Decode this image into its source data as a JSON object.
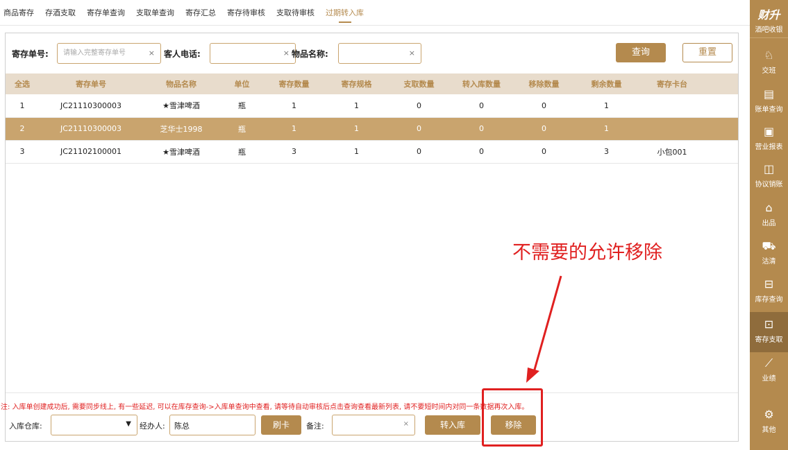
{
  "tabs": [
    {
      "label": "商品寄存"
    },
    {
      "label": "存酒支取"
    },
    {
      "label": "寄存单查询"
    },
    {
      "label": "支取单查询"
    },
    {
      "label": "寄存汇总"
    },
    {
      "label": "寄存待审核"
    },
    {
      "label": "支取待审核"
    },
    {
      "label": "过期转入库"
    }
  ],
  "search": {
    "order_no_label": "寄存单号:",
    "order_no_placeholder": "请输入完整寄存单号",
    "phone_label": "客人电话:",
    "phone_value": "",
    "item_label": "物品名称:",
    "item_value": "",
    "clear_icon": "×",
    "query_button": "查询",
    "reset_button": "重置"
  },
  "table": {
    "headers": [
      "全选",
      "寄存单号",
      "物品名称",
      "单位",
      "寄存数量",
      "寄存规格",
      "支取数量",
      "转入库数量",
      "移除数量",
      "剩余数量",
      "寄存卡台"
    ],
    "rows": [
      [
        "1",
        "JC21110300003",
        "★雪津啤酒",
        "瓶",
        "1",
        "1",
        "0",
        "0",
        "0",
        "1",
        ""
      ],
      [
        "2",
        "JC21110300003",
        "芝华士1998",
        "瓶",
        "1",
        "1",
        "0",
        "0",
        "0",
        "1",
        ""
      ],
      [
        "3",
        "JC21102100001",
        "★雪津啤酒",
        "瓶",
        "3",
        "1",
        "0",
        "0",
        "0",
        "3",
        "小包001"
      ]
    ]
  },
  "note": "注: 入库单创建成功后, 需要同步线上, 有一些延迟, 可以在库存查询->入库单查询中查看, 请等待自动审核后点击查询查看最新列表, 请不要短时间内对同一条数据再次入库。",
  "bottom": {
    "warehouse_label": "入库仓库:",
    "warehouse_value": "",
    "dropdown_arrow": "▼",
    "handler_label": "经办人:",
    "handler_value": "陈总",
    "swipe_button": "刷卡",
    "remark_label": "备注:",
    "remark_value": "",
    "clear_icon": "×",
    "transfer_button": "转入库",
    "remove_button": "移除"
  },
  "annotation": {
    "text": "不需要的允许移除"
  },
  "sidebar": {
    "brand_title": "财升",
    "brand_sub": "酒吧收银",
    "items": [
      {
        "label": "交班",
        "icon": "person-switch-icon"
      },
      {
        "label": "账单查询",
        "icon": "receipt-icon"
      },
      {
        "label": "营业报表",
        "icon": "report-icon"
      },
      {
        "label": "协议销账",
        "icon": "agreement-icon"
      },
      {
        "label": "出品",
        "icon": "dish-icon"
      },
      {
        "label": "沽清",
        "icon": "cart-icon"
      },
      {
        "label": "库存查询",
        "icon": "box-icon"
      },
      {
        "label": "寄存支取",
        "icon": "locker-icon"
      },
      {
        "label": "业绩",
        "icon": "chart-icon"
      },
      {
        "label": "其他",
        "icon": "gear-icon"
      }
    ]
  },
  "colors": {
    "accent": "#b48a4e",
    "header_bg": "#e8dccc",
    "selected_row": "#c9a46e",
    "annotation_red": "#e02020"
  }
}
